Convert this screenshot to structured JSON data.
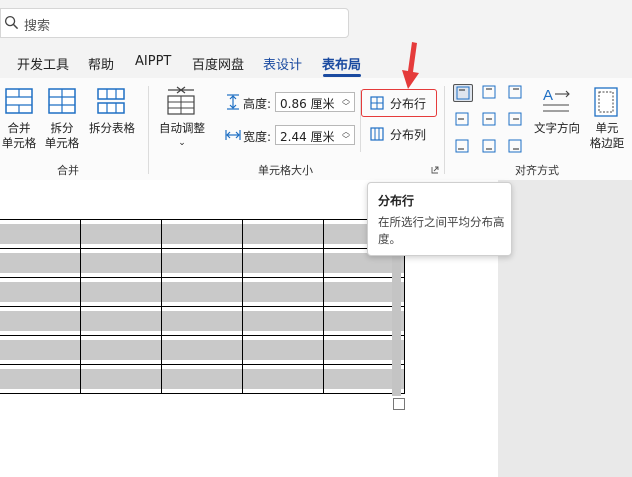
{
  "search": {
    "placeholder": "搜索"
  },
  "tabs": [
    {
      "label": "开发工具"
    },
    {
      "label": "帮助"
    },
    {
      "label": "AIPPT"
    },
    {
      "label": "百度网盘"
    },
    {
      "label": "表设计"
    },
    {
      "label": "表布局",
      "selected": true
    }
  ],
  "ribbon": {
    "merge_group": {
      "label": "合并",
      "buttons": [
        {
          "label_line1": "合并",
          "label_line2": "单元格"
        },
        {
          "label_line1": "拆分",
          "label_line2": "单元格"
        },
        {
          "label_line1": "拆分表格"
        }
      ]
    },
    "cell_size_group": {
      "label": "单元格大小",
      "autofit": {
        "label": "自动调整"
      },
      "height": {
        "label": "高度:",
        "value": "0.86 厘米"
      },
      "width": {
        "label": "宽度:",
        "value": "2.44 厘米"
      },
      "distribute_rows": {
        "label": "分布行"
      },
      "distribute_cols": {
        "label": "分布列"
      }
    },
    "align_group": {
      "label": "对齐方式",
      "text_direction": {
        "label": "文字方向"
      },
      "cell_margins": {
        "label_line1": "单元",
        "label_line2": "格边距"
      }
    }
  },
  "tooltip": {
    "title": "分布行",
    "description": "在所选行之间平均分布高度。"
  },
  "colors": {
    "accent": "#1a4aa0",
    "highlight_border": "#e53b3b",
    "arrow": "#e53b3b",
    "selected_cell": "#c9c9c9"
  }
}
